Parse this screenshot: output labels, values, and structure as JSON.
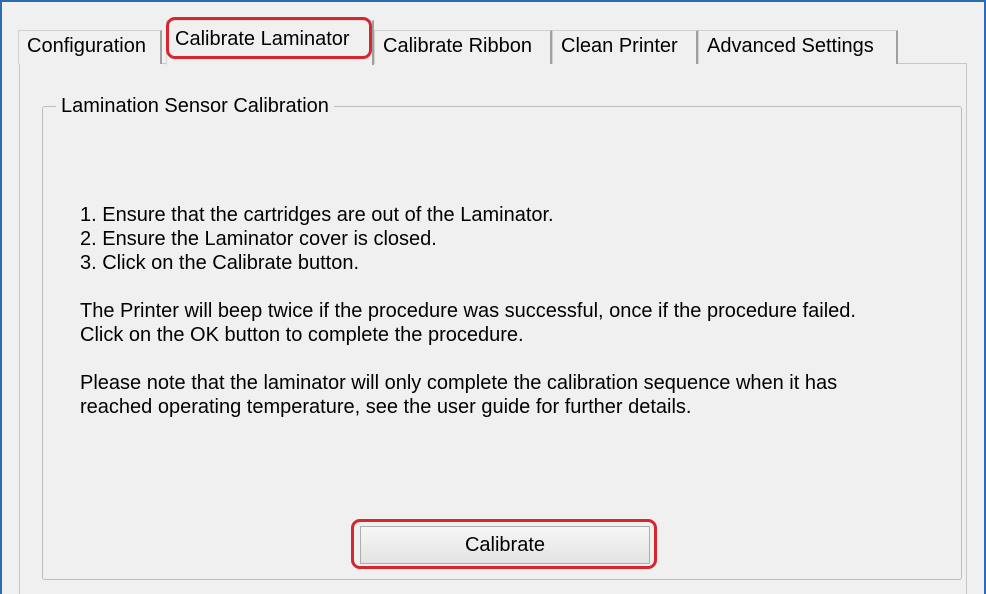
{
  "tabs": [
    {
      "label": "Configuration",
      "active": false
    },
    {
      "label": "Calibrate Laminator",
      "active": true
    },
    {
      "label": "Calibrate Ribbon",
      "active": false
    },
    {
      "label": "Clean Printer",
      "active": false
    },
    {
      "label": "Advanced Settings",
      "active": false
    }
  ],
  "group": {
    "title": "Lamination Sensor Calibration"
  },
  "instructions": {
    "step1": "1. Ensure that the cartridges are out of the Laminator.",
    "step2": "2. Ensure the Laminator cover is closed.",
    "step3": "3. Click on the Calibrate button.",
    "result_line1": "The Printer will beep twice if the procedure was successful, once if the procedure failed.",
    "result_line2": "Click on the OK button to complete the procedure.",
    "note_line1": "Please note that the laminator will only complete the calibration sequence when it has",
    "note_line2": "reached operating temperature, see the user guide for further details."
  },
  "calibrate_button": {
    "label": "Calibrate"
  },
  "colors": {
    "highlight": "#d7262f",
    "window_border": "#2b6cb0",
    "background": "#f0f0f0"
  }
}
